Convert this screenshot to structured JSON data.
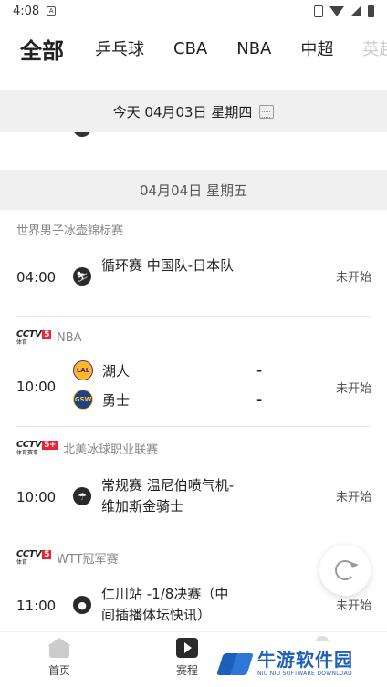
{
  "statusbar": {
    "time": "4:08",
    "left_icon": "A"
  },
  "tabs": [
    "全部",
    "乒乓球",
    "CBA",
    "NBA",
    "中超",
    "英超"
  ],
  "date_bar": {
    "label": "今天 04月03日 星期四"
  },
  "day_header": {
    "label": "04月04日 星期五"
  },
  "sections": [
    {
      "league": "世界男子冰壶锦标赛",
      "time": "04:00",
      "title": "循环赛 中国队-日本队",
      "status": "未开始",
      "icon": "curling-icon"
    },
    {
      "league": "NBA",
      "channel": {
        "name": "CCTV",
        "number": "5",
        "sub": "体育"
      },
      "time": "10:00",
      "home_team": "湖人",
      "away_team": "勇士",
      "home_score": "-",
      "away_score": "-",
      "home_logo": "LAL",
      "away_logo": "GSW",
      "status": "未开始"
    },
    {
      "league": "北美冰球职业联赛",
      "channel": {
        "name": "CCTV",
        "number": "5+",
        "sub": "体育赛事"
      },
      "time": "10:00",
      "title": "常规赛 温尼伯喷气机-维加斯金骑士",
      "status": "未开始",
      "icon": "nhl-icon"
    },
    {
      "league": "WTT冠军赛",
      "channel": {
        "name": "CCTV",
        "number": "5",
        "sub": "体育"
      },
      "time": "11:00",
      "title": "仁川站 -1/8决赛（中间插播体坛快讯）",
      "status": "未开始",
      "icon": "table-tennis-icon"
    }
  ],
  "bottom_nav": {
    "home": "首页",
    "schedule": "赛程"
  },
  "watermark": {
    "cn": "牛游软件园",
    "en": "NIU NIU SOFTWARE DOWNLOAD"
  },
  "colors": {
    "accent": "#1f5fb8",
    "divider": "#e8e8e8",
    "band": "#f0f0f0"
  }
}
